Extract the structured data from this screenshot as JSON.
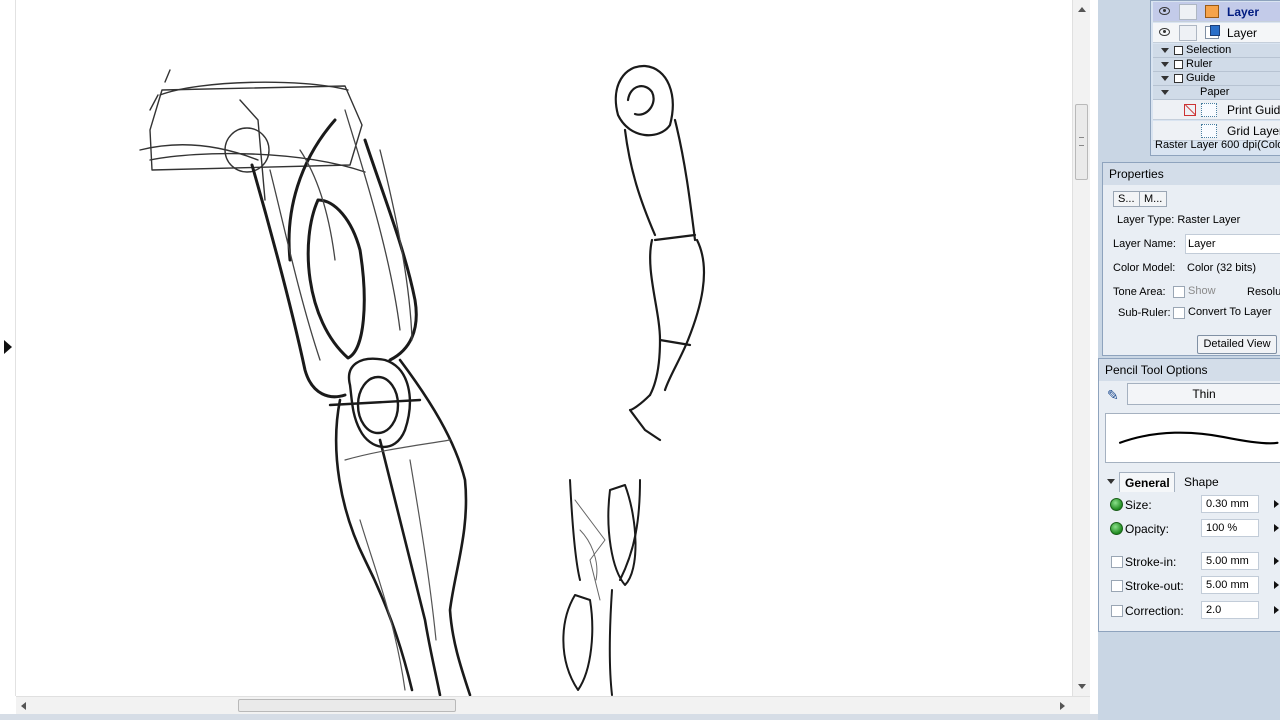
{
  "layers": {
    "top_row_label": "Layer",
    "second_row_label": "Layer",
    "groups": [
      "Selection",
      "Ruler",
      "Guide",
      "Paper"
    ],
    "print_guide_label": "Print Guide",
    "grid_layer_label": "Grid Layer",
    "status": "Raster Layer 600 dpi(Color"
  },
  "properties": {
    "title": "Properties",
    "tab1": "S...",
    "tab2": "M...",
    "layer_type": "Layer Type: Raster Layer",
    "layer_name_label": "Layer Name:",
    "layer_name_value": "Layer",
    "color_model_label": "Color Model:",
    "color_model_value": "Color (32 bits)",
    "tone_area_label": "Tone Area:",
    "tone_show_label": "Show",
    "resolution_label": "Resolu",
    "sub_ruler_label": "Sub-Ruler:",
    "convert_label": "Convert To Layer",
    "detailed_view": "Detailed View"
  },
  "pencil": {
    "title": "Pencil Tool Options",
    "preset": "Thin",
    "tab_general": "General",
    "tab_shape": "Shape",
    "options": [
      {
        "label": "Size:",
        "value": "0.30 mm",
        "control": "dot"
      },
      {
        "label": "Opacity:",
        "value": "100 %",
        "control": "dot"
      },
      {
        "label": "Stroke-in:",
        "value": "5.00 mm",
        "control": "check"
      },
      {
        "label": "Stroke-out:",
        "value": "5.00 mm",
        "control": "check"
      },
      {
        "label": "Correction:",
        "value": "2.0",
        "control": "check"
      }
    ]
  }
}
